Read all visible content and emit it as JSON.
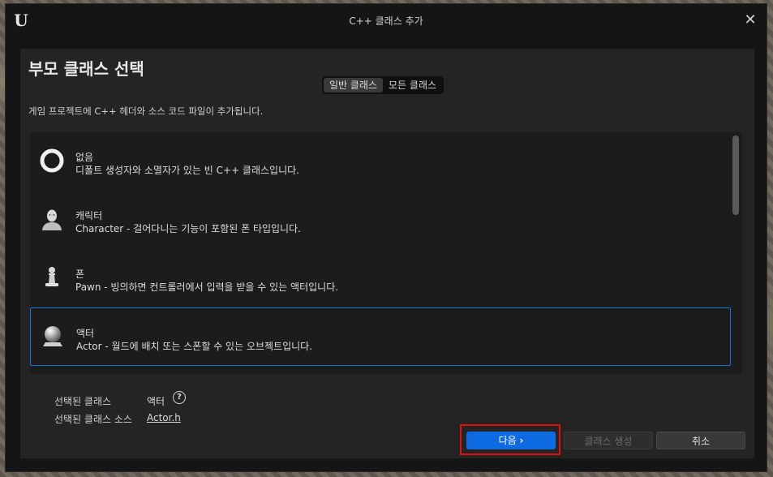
{
  "window": {
    "title": "C++ 클래스 추가",
    "accent": "#0d6ae0"
  },
  "heading": "부모 클래스 선택",
  "tabs": [
    {
      "label": "일반 클래스",
      "active": true
    },
    {
      "label": "모든 클래스",
      "active": false
    }
  ],
  "description": "게임 프로젝트에 C++ 헤더와 소스 코드 파일이 추가됩니다.",
  "classes": [
    {
      "name": "없음",
      "desc": "디폴트 생성자와 소멸자가 있는 빈 C++ 클래스입니다.",
      "icon": "ring-icon"
    },
    {
      "name": "캐릭터",
      "desc": "Character - 걸어다니는 기능이 포함된 폰 타입입니다.",
      "icon": "character-icon"
    },
    {
      "name": "폰",
      "desc": "Pawn - 빙의하면 컨트롤러에서 입력을 받을 수 있는 액터입니다.",
      "icon": "pawn-icon"
    },
    {
      "name": "액터",
      "desc": "Actor - 월드에 배치 또는 스폰할 수 있는 오브젝트입니다.",
      "icon": "actor-sphere-icon",
      "selected": true
    }
  ],
  "info": {
    "selected_class_label": "선택된 클래스",
    "selected_class_value": "액터",
    "selected_source_label": "선택된 클래스 소스",
    "selected_source_value": "Actor.h"
  },
  "buttons": {
    "next": "다음",
    "next_chevron": "›",
    "create": "클래스 생성",
    "cancel": "취소"
  },
  "close_glyph": "✕",
  "help_glyph": "?"
}
